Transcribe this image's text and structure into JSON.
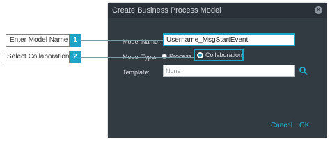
{
  "dialog": {
    "title": "Create Business Process Model",
    "close_icon": "close-icon"
  },
  "form": {
    "model_name_label": "Model Name:",
    "model_name_value": "Username_MsgStartEvent",
    "model_type_label": "Model Type:",
    "type_options": [
      {
        "label": "Process",
        "selected": false
      },
      {
        "label": "Collaboration",
        "selected": true
      }
    ],
    "template_label": "Template:",
    "template_value": "None",
    "search_icon": "search-icon"
  },
  "footer": {
    "cancel_label": "Cancel",
    "ok_label": "OK"
  },
  "callouts": [
    {
      "number": "1",
      "text": "Enter Model Name"
    },
    {
      "number": "2",
      "text": "Select Collaboration"
    }
  ],
  "colors": {
    "accent": "#1aa6c9",
    "dialog_bg": "#323a42",
    "header_bg": "#2a3138",
    "callout_badge": "#1fa3c6"
  }
}
